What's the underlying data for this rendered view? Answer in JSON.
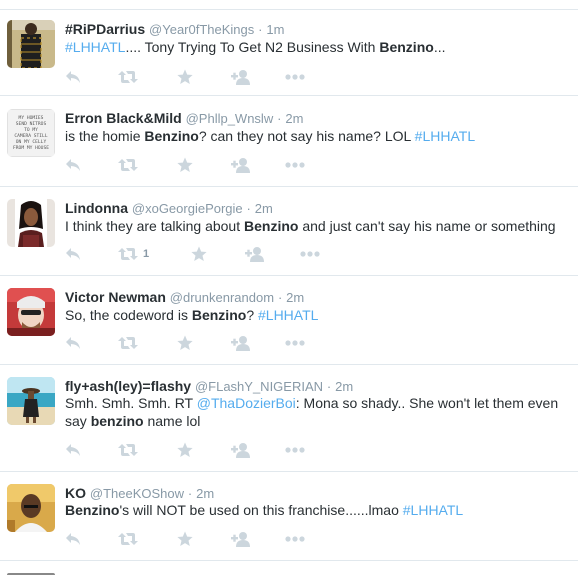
{
  "tweets": [
    {
      "fullname": "#RiPDarrius",
      "handle": "@Year0fTheKings",
      "dot": "·",
      "time": "1m",
      "line1": [
        {
          "t": "#LHHATL",
          "c": "hashtag"
        },
        {
          "t": "....    Tony Trying To Get N2 Business With ",
          "c": ""
        },
        {
          "t": "Benzino",
          "c": "b"
        },
        {
          "t": "...",
          "c": ""
        }
      ],
      "retweet_count": ""
    },
    {
      "fullname": "Erron Black&Mild",
      "handle": "@Phllp_Wnslw",
      "dot": "·",
      "time": "2m",
      "line1": [
        {
          "t": "is the homie ",
          "c": ""
        },
        {
          "t": "Benzino",
          "c": "b"
        },
        {
          "t": "? can they not say his name? LOL ",
          "c": ""
        },
        {
          "t": "#LHHATL",
          "c": "hashtag"
        }
      ],
      "retweet_count": ""
    },
    {
      "fullname": "Lindonna",
      "handle": "@xoGeorgiePorgie",
      "dot": "·",
      "time": "2m",
      "line1": [
        {
          "t": "I think they are talking about ",
          "c": ""
        },
        {
          "t": "Benzino",
          "c": "b"
        },
        {
          "t": " and just can't say his name or something",
          "c": ""
        }
      ],
      "retweet_count": "1"
    },
    {
      "fullname": "Victor Newman",
      "handle": "@drunkenrandom",
      "dot": "·",
      "time": "2m",
      "line1": [
        {
          "t": "So, the codeword is ",
          "c": ""
        },
        {
          "t": "Benzino",
          "c": "b"
        },
        {
          "t": "? ",
          "c": ""
        },
        {
          "t": "#LHHATL",
          "c": "hashtag"
        }
      ],
      "retweet_count": ""
    },
    {
      "fullname": "fly+ash(ley)=flashy",
      "handle": "@FLashY_NIGERIAN",
      "dot": "·",
      "time": "2m",
      "line1": [
        {
          "t": "Smh. Smh. Smh. RT ",
          "c": ""
        },
        {
          "t": "@ThaDozierBoi",
          "c": "mention"
        },
        {
          "t": ": Mona so shady.. She won't let them even",
          "c": ""
        }
      ],
      "line2": [
        {
          "t": "say ",
          "c": ""
        },
        {
          "t": "benzino",
          "c": "b"
        },
        {
          "t": " name lol",
          "c": ""
        }
      ],
      "retweet_count": ""
    },
    {
      "fullname": "KO",
      "handle": "@TheeKOShow",
      "dot": "·",
      "time": "2m",
      "line1": [
        {
          "t": "Benzino",
          "c": "b"
        },
        {
          "t": "'s will NOT be used on this franchise......lmao ",
          "c": ""
        },
        {
          "t": "#LHHATL",
          "c": "hashtag"
        }
      ],
      "retweet_count": ""
    }
  ],
  "avatar_text": "MY HOMIES SEND NITROS TO MY CAMERA STILL ON MY CELLY FROM MY HOUSE",
  "colors": {
    "hashtag": "#55acee",
    "action_icon": "#ccd6dd",
    "meta": "#8899a6",
    "text": "#292f33",
    "border": "#e1e8ed"
  },
  "icons": [
    "reply-icon",
    "retweet-icon",
    "favorite-icon",
    "follow-icon",
    "more-icon"
  ]
}
